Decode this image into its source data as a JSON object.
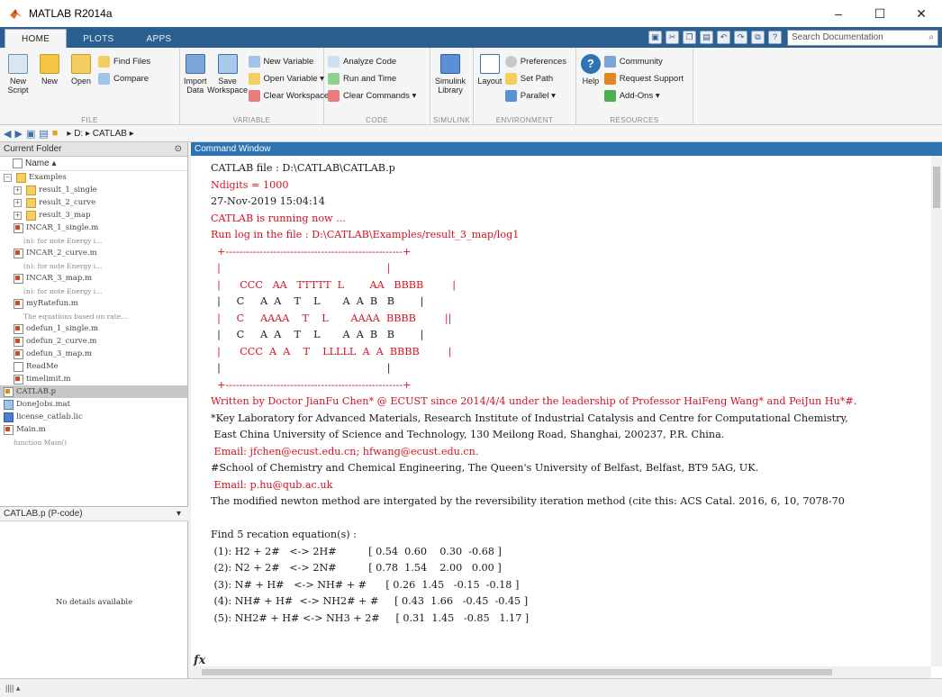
{
  "window": {
    "title": "MATLAB R2014a",
    "minimize": "–",
    "maximize": "☐",
    "close": "✕"
  },
  "tabs": [
    {
      "label": "HOME"
    },
    {
      "label": "PLOTS"
    },
    {
      "label": "APPS"
    }
  ],
  "search": {
    "placeholder": "Search Documentation"
  },
  "ribbon": {
    "file": {
      "label": "FILE",
      "new_script": "New\nScript",
      "new": "New",
      "open": "Open",
      "find_files": "Find Files",
      "compare": "Compare"
    },
    "variable": {
      "label": "VARIABLE",
      "import_data": "Import\nData",
      "save_workspace": "Save\nWorkspace",
      "new_variable": "New Variable",
      "open_variable": "Open Variable ▾",
      "clear_workspace": "Clear Workspace ▾"
    },
    "code": {
      "label": "CODE",
      "analyze_code": "Analyze Code",
      "run_and_time": "Run and Time",
      "clear_commands": "Clear Commands ▾"
    },
    "simulink": {
      "label": "SIMULINK",
      "simulink_library": "Simulink\nLibrary"
    },
    "environment": {
      "label": "ENVIRONMENT",
      "layout": "Layout",
      "preferences": "Preferences",
      "set_path": "Set Path",
      "parallel": "Parallel ▾"
    },
    "resources": {
      "label": "RESOURCES",
      "help": "Help",
      "community": "Community",
      "request_support": "Request Support",
      "add_ons": "Add-Ons ▾"
    }
  },
  "address": {
    "path": "▸ D: ▸ CATLAB ▸"
  },
  "current_folder": {
    "title": "Current Folder",
    "column": "Name ▴",
    "items": [
      {
        "name": "Examples",
        "type": "folder",
        "level": 0,
        "expander": "⊟"
      },
      {
        "name": "result_1_single",
        "type": "folder",
        "level": 1,
        "expander": "⊞"
      },
      {
        "name": "result_2_curve",
        "type": "folder",
        "level": 1,
        "expander": "⊞"
      },
      {
        "name": "result_3_map",
        "type": "folder",
        "level": 1,
        "expander": "⊞"
      },
      {
        "name": "INCAR_1_single.m",
        "type": "mfile",
        "level": 1
      },
      {
        "name": "(n): for note        Energy i...",
        "type": "note",
        "level": 2
      },
      {
        "name": "INCAR_2_curve.m",
        "type": "mfile",
        "level": 1
      },
      {
        "name": "(n): for note        Energy i...",
        "type": "note",
        "level": 2
      },
      {
        "name": "INCAR_3_map.m",
        "type": "mfile",
        "level": 1
      },
      {
        "name": "(n): for note        Energy i...",
        "type": "note",
        "level": 2
      },
      {
        "name": "myRatefun.m",
        "type": "mfile",
        "level": 1
      },
      {
        "name": "The equations based on rate...",
        "type": "note",
        "level": 2
      },
      {
        "name": "odefun_1_single.m",
        "type": "mfile",
        "level": 1
      },
      {
        "name": "odefun_2_curve.m",
        "type": "mfile",
        "level": 1
      },
      {
        "name": "odefun_3_map.m",
        "type": "mfile",
        "level": 1
      },
      {
        "name": "ReadMe",
        "type": "doc",
        "level": 1
      },
      {
        "name": "timelimit.m",
        "type": "mfile",
        "level": 1
      },
      {
        "name": "CATLAB.p",
        "type": "pfile",
        "level": 0,
        "selected": true
      },
      {
        "name": "DoneJobs.mat",
        "type": "mat",
        "level": 0
      },
      {
        "name": "license_catlab.lic",
        "type": "lic",
        "level": 0
      },
      {
        "name": "Main.m",
        "type": "mfile",
        "level": 0
      },
      {
        "name": "function Main()",
        "type": "note",
        "level": 1
      }
    ],
    "details_title": "CATLAB.p (P-code)",
    "no_details": "No details available"
  },
  "command_window": {
    "title": "Command Window",
    "lines": [
      {
        "text": "CATLAB file : D:\\CATLAB\\CATLAB.p",
        "color": "black"
      },
      {
        "text": "Ndigits = 1000",
        "color": "red"
      },
      {
        "text": "27-Nov-2019 15:04:14",
        "color": "black"
      },
      {
        "text": "CATLAB is running now ...",
        "color": "red"
      },
      {
        "text": "Run log in the file : D:\\CATLAB\\Examples/result_3_map/log1",
        "color": "red"
      },
      {
        "text": "  +----------------------------------------------------+",
        "color": "red"
      },
      {
        "text": "  |                                                    |",
        "color": "red"
      },
      {
        "text": "  |      CCC   AA   TTTTT  L        AA   BBBB         |",
        "color": "red"
      },
      {
        "text": "  |     C     A  A    T    L       A  A  B   B        |",
        "color": "black"
      },
      {
        "text": "  |     C     AAAA    T    L       AAAA  BBBB         ||",
        "color": "red"
      },
      {
        "text": "  |     C     A  A    T    L       A  A  B   B        |",
        "color": "black"
      },
      {
        "text": "  |      CCC  A  A    T    LLLLL  A  A  BBBB         |",
        "color": "red"
      },
      {
        "text": "  |                                                    |",
        "color": "black"
      },
      {
        "text": "  +----------------------------------------------------+",
        "color": "red"
      },
      {
        "text": "Written by Doctor JianFu Chen* @ ECUST since 2014/4/4 under the leadership of Professor HaiFeng Wang* and PeiJun Hu*#.",
        "color": "red"
      },
      {
        "text": "*Key Laboratory for Advanced Materials, Research Institute of Industrial Catalysis and Centre for Computational Chemistry,",
        "color": "black"
      },
      {
        "text": " East China University of Science and Technology, 130 Meilong Road, Shanghai, 200237, P.R. China.",
        "color": "black"
      },
      {
        "text": " Email: jfchen@ecust.edu.cn; hfwang@ecust.edu.cn.",
        "color": "red"
      },
      {
        "text": "#School of Chemistry and Chemical Engineering, The Queen's University of Belfast, Belfast, BT9 5AG, UK.",
        "color": "black"
      },
      {
        "text": " Email: p.hu@qub.ac.uk",
        "color": "red"
      },
      {
        "text": "The modified newton method are intergated by the reversibility iteration method (cite this: ACS Catal. 2016, 6, 10, 7078-70",
        "color": "black"
      },
      {
        "text": " ",
        "color": "black"
      },
      {
        "text": "Find 5 recation equation(s) :",
        "color": "black"
      },
      {
        "text": " (1): H2 + 2#   <-> 2H#          [ 0.54  0.60    0.30  -0.68 ]",
        "color": "black"
      },
      {
        "text": " (2): N2 + 2#   <-> 2N#          [ 0.78  1.54    2.00   0.00 ]",
        "color": "black"
      },
      {
        "text": " (3): N# + H#   <-> NH# + #      [ 0.26  1.45   -0.15  -0.18 ]",
        "color": "black"
      },
      {
        "text": " (4): NH# + H#  <-> NH2# + #     [ 0.43  1.66   -0.45  -0.45 ]",
        "color": "black"
      },
      {
        "text": " (5): NH2# + H# <-> NH3 + 2#     [ 0.31  1.45   -0.85   1.17 ]",
        "color": "black"
      }
    ],
    "prompt_symbol": "fx"
  },
  "status": {
    "text": "|||| ▴"
  },
  "colors": {
    "tabbar": "#2b5f8f",
    "command_title": "#2e73b3",
    "red_text": "#d3121f"
  }
}
